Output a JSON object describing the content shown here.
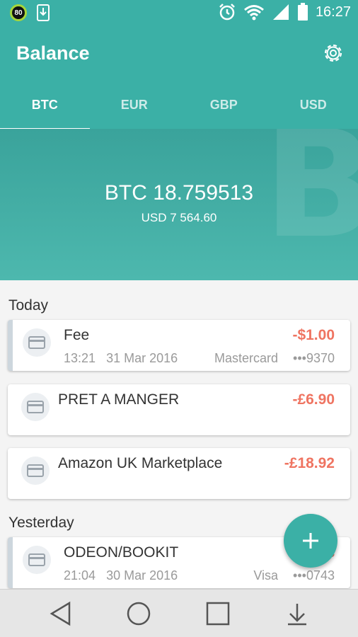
{
  "status_bar": {
    "badge": "80",
    "time": "16:27",
    "icons": [
      "battery-saver-icon",
      "download-icon",
      "alarm-icon",
      "wifi-icon",
      "signal-icon",
      "battery-icon"
    ]
  },
  "app_bar": {
    "title": "Balance",
    "settings_icon": "gear-icon"
  },
  "tabs": [
    {
      "label": "BTC",
      "active": true
    },
    {
      "label": "EUR",
      "active": false
    },
    {
      "label": "GBP",
      "active": false
    },
    {
      "label": "USD",
      "active": false
    }
  ],
  "hero": {
    "watermark": "B",
    "amount": "BTC 18.759513",
    "sub_amount": "USD 7 564.60"
  },
  "sections": [
    {
      "title": "Today",
      "transactions": [
        {
          "title": "Fee",
          "amount": "-$1.00",
          "time": "13:21",
          "date": "31 Mar 2016",
          "method": "Mastercard",
          "card": "•••9370"
        },
        {
          "title": "PRET A MANGER",
          "amount": "-£6.90"
        },
        {
          "title": "Amazon UK Marketplace",
          "amount": "-£18.92"
        }
      ]
    },
    {
      "title": "Yesterday",
      "transactions": [
        {
          "title": "ODEON/BOOKIT",
          "amount": "-£",
          "time": "21:04",
          "date": "30 Mar 2016",
          "method": "Visa",
          "card": "•••0743"
        }
      ]
    }
  ],
  "fab": {
    "icon": "plus-icon"
  },
  "nav_bar": {
    "icons": [
      "back-icon",
      "home-icon",
      "recents-icon",
      "notifications-down-icon"
    ]
  },
  "colors": {
    "primary": "#3bb0a6",
    "negative": "#ef7461"
  }
}
